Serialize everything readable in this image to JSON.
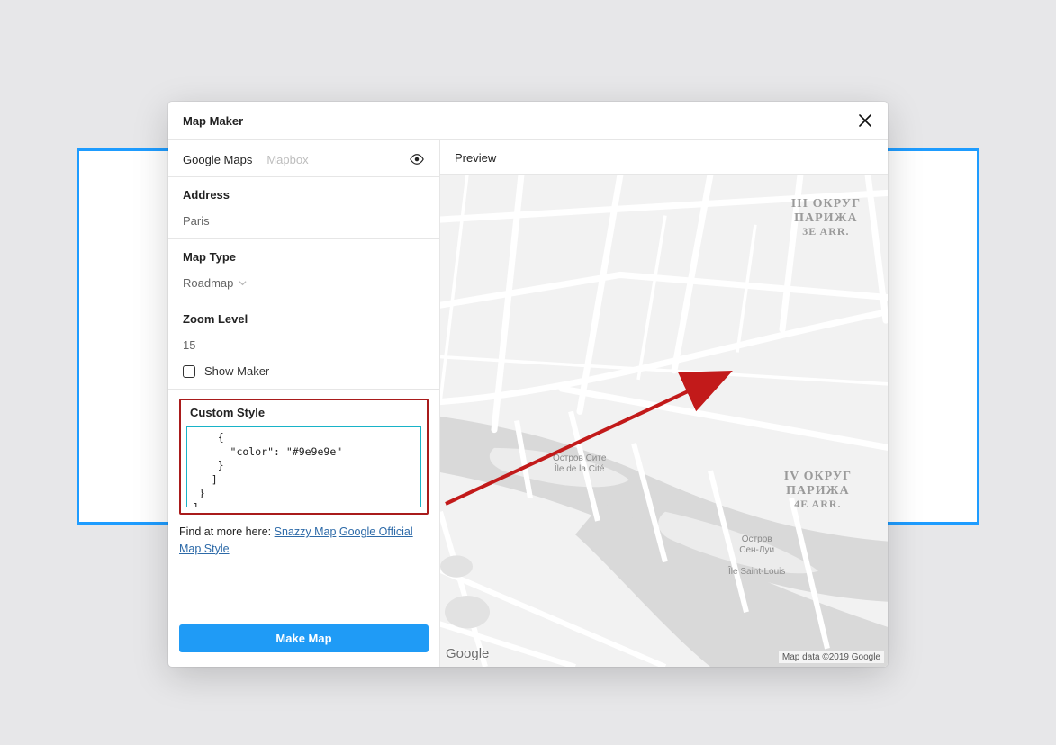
{
  "dialog": {
    "title": "Map Maker"
  },
  "tabs": {
    "google_maps": "Google Maps",
    "mapbox": "Mapbox"
  },
  "preview": {
    "label": "Preview"
  },
  "address": {
    "label": "Address",
    "value": "Paris"
  },
  "map_type": {
    "label": "Map Type",
    "value": "Roadmap"
  },
  "zoom": {
    "label": "Zoom Level",
    "value": "15"
  },
  "show_marker": {
    "label": "Show Maker"
  },
  "custom_style": {
    "label": "Custom Style",
    "code": "    {\n      \"color\": \"#9e9e9e\"\n    }\n   ]\n }\n]"
  },
  "find_more": {
    "prefix": "Find at more here: ",
    "link1": "Snazzy Map",
    "link2": "Google Official Map Style"
  },
  "make_button": "Make Map",
  "map": {
    "district3": {
      "top": "ІІІ ОКРУГ",
      "mid": "ПАРИЖА",
      "bot": "3E ARR."
    },
    "district4": {
      "top": "IV ОКРУГ",
      "mid": "ПАРИЖА",
      "bot": "4E ARR."
    },
    "cite": {
      "ru": "Остров Сите",
      "fr": "Île de la Cité"
    },
    "stlouis": {
      "ru": "Остров\nСен-Луи",
      "fr": "Île Saint-Louis"
    },
    "google": "Google",
    "attribution": "Map data ©2019 Google"
  }
}
